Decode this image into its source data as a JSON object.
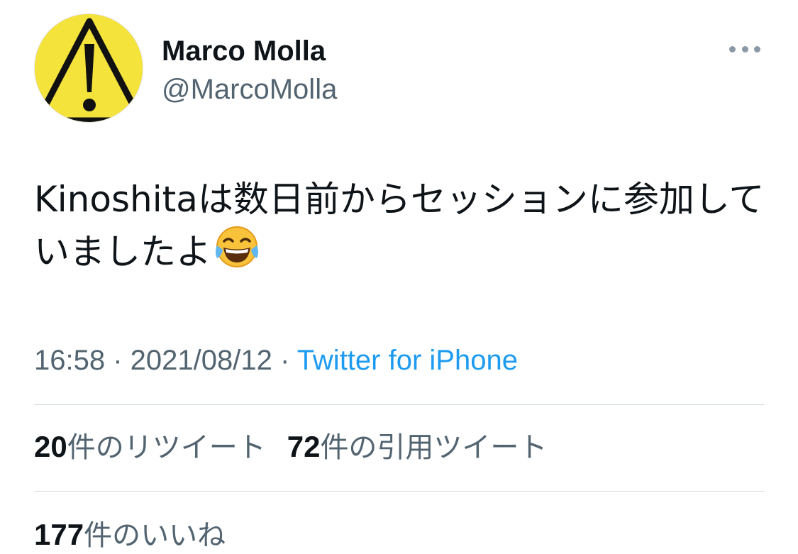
{
  "author": {
    "display_name": "Marco Molla",
    "handle": "@MarcoMolla",
    "avatar_icon": "warning-icon"
  },
  "more_icon": "more-horizontal-icon",
  "tweet": {
    "text": "Kinoshitaは数日前からセッションに参加していましたよ",
    "emoji_icon": "face-with-tears-of-joy-icon"
  },
  "meta": {
    "time": "16:58",
    "separator": " · ",
    "date": "2021/08/12",
    "source": "Twitter for iPhone"
  },
  "stats": {
    "retweets": {
      "count": "20",
      "label": "件のリツイート"
    },
    "quotes": {
      "count": "72",
      "label": "件の引用ツイート"
    },
    "likes": {
      "count": "177",
      "label": "件のいいね"
    }
  },
  "colors": {
    "primary_text": "#0f1419",
    "secondary_text": "#536471",
    "link": "#1d9bf0",
    "divider": "#cfd9de",
    "avatar_yellow": "#f4e33b"
  }
}
